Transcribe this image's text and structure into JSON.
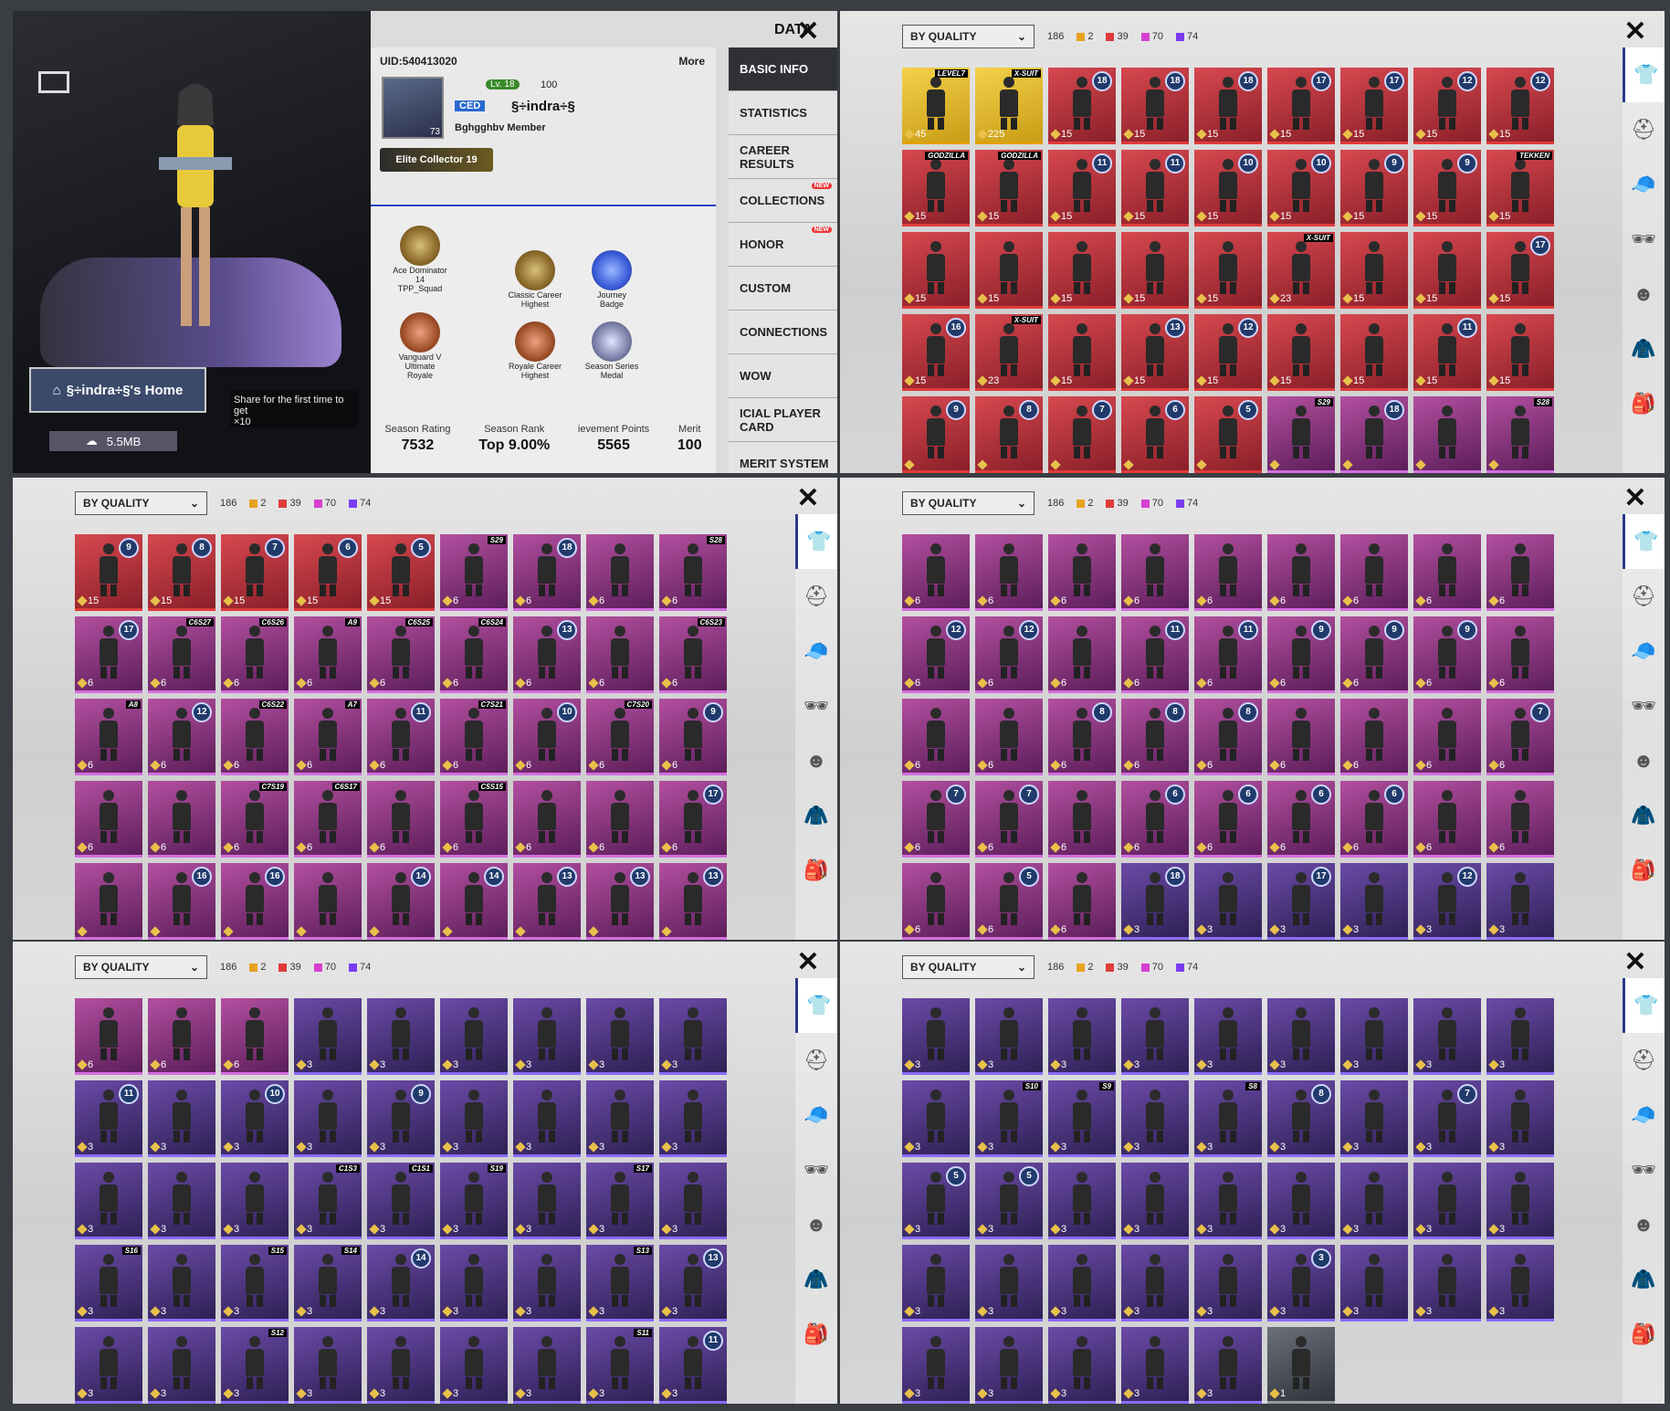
{
  "basic_info": {
    "title": "DATA",
    "uid": "UID:540413020",
    "more": "More",
    "level": "Lv. 18",
    "rating_small": "100",
    "crew_tag": "CED",
    "player_name": "§÷indra÷§",
    "clan": "Bghgghbv  Member",
    "avatar_level": "73",
    "elite": "Elite Collector 19",
    "home_name": "§÷indra÷§'s Home",
    "home_size": "5.5MB",
    "share_text": "Share for the first time to get",
    "share_reward": "×10",
    "medals": [
      {
        "label": "Ace Dominator 14",
        "sub": "TPP_Squad"
      },
      {
        "label": "Classic Career Highest",
        "sub": ""
      },
      {
        "label": "Journey Badge",
        "sub": ""
      },
      {
        "label": "Vanguard V",
        "sub": "Ultimate Royale"
      },
      {
        "label": "Royale Career Highest",
        "sub": ""
      },
      {
        "label": "Season Series Medal",
        "sub": ""
      }
    ],
    "stats": [
      {
        "label": "Season Rating",
        "value": "7532"
      },
      {
        "label": "Season Rank",
        "value": "Top 9.00%"
      },
      {
        "label": "ievement Points",
        "value": "5565"
      },
      {
        "label": "Merit",
        "value": "100"
      }
    ],
    "menu": [
      {
        "label": "BASIC INFO",
        "active": true
      },
      {
        "label": "STATISTICS"
      },
      {
        "label": "CAREER RESULTS"
      },
      {
        "label": "COLLECTIONS",
        "new": "NEW"
      },
      {
        "label": "HONOR",
        "new": "NEW"
      },
      {
        "label": "CUSTOM"
      },
      {
        "label": "CONNECTIONS"
      },
      {
        "label": "WOW"
      },
      {
        "label": "ICIAL PLAYER CARD"
      },
      {
        "label": "MERIT SYSTEM"
      }
    ]
  },
  "filter": {
    "sort": "BY QUALITY",
    "total": "186",
    "quality_counts": [
      {
        "color": "#e8a21f",
        "count": "2"
      },
      {
        "color": "#e03b3b",
        "count": "39"
      },
      {
        "color": "#d63fd0",
        "count": "70"
      },
      {
        "color": "#7a3cf0",
        "count": "74"
      }
    ]
  },
  "icons": {
    "close": "✕",
    "categories": [
      "outfit-icon",
      "helmet-icon",
      "cap-icon",
      "glasses-icon",
      "mask-icon",
      "jacket-icon",
      "backpack-icon"
    ]
  },
  "panels": [
    {
      "cards": [
        {
          "q": "gold",
          "n": "45",
          "tag": "LEVEL7"
        },
        {
          "q": "gold",
          "n": "225",
          "tag": "X-SUIT"
        },
        {
          "q": "red",
          "n": "15",
          "b": "18"
        },
        {
          "q": "red",
          "n": "15",
          "b": "18"
        },
        {
          "q": "red",
          "n": "15",
          "b": "18"
        },
        {
          "q": "red",
          "n": "15",
          "b": "17"
        },
        {
          "q": "red",
          "n": "15",
          "b": "17"
        },
        {
          "q": "red",
          "n": "15",
          "b": "12"
        },
        {
          "q": "red",
          "n": "15",
          "b": "12"
        },
        {
          "q": "red",
          "n": "15",
          "tag": "GODZILLA"
        },
        {
          "q": "red",
          "n": "15",
          "tag": "GODZILLA"
        },
        {
          "q": "red",
          "n": "15",
          "b": "11"
        },
        {
          "q": "red",
          "n": "15",
          "b": "11"
        },
        {
          "q": "red",
          "n": "15",
          "b": "10"
        },
        {
          "q": "red",
          "n": "15",
          "b": "10"
        },
        {
          "q": "red",
          "n": "15",
          "b": "9"
        },
        {
          "q": "red",
          "n": "15",
          "b": "9"
        },
        {
          "q": "red",
          "n": "15",
          "tag": "TEKKEN"
        },
        {
          "q": "red",
          "n": "15"
        },
        {
          "q": "red",
          "n": "15"
        },
        {
          "q": "red",
          "n": "15"
        },
        {
          "q": "red",
          "n": "15"
        },
        {
          "q": "red",
          "n": "15"
        },
        {
          "q": "red",
          "n": "23",
          "tag": "X-SUIT"
        },
        {
          "q": "red",
          "n": "15"
        },
        {
          "q": "red",
          "n": "15"
        },
        {
          "q": "red",
          "n": "15",
          "b": "17"
        },
        {
          "q": "red",
          "n": "15",
          "b": "16"
        },
        {
          "q": "red",
          "n": "23",
          "tag": "X-SUIT"
        },
        {
          "q": "red",
          "n": "15"
        },
        {
          "q": "red",
          "n": "15",
          "b": "13"
        },
        {
          "q": "red",
          "n": "15",
          "b": "12"
        },
        {
          "q": "red",
          "n": "15"
        },
        {
          "q": "red",
          "n": "15"
        },
        {
          "q": "red",
          "n": "15",
          "b": "11"
        },
        {
          "q": "red",
          "n": "15"
        },
        {
          "q": "red",
          "n": "",
          "b": "9"
        },
        {
          "q": "red",
          "n": "",
          "b": "8"
        },
        {
          "q": "red",
          "n": "",
          "b": "7"
        },
        {
          "q": "red",
          "n": "",
          "b": "6"
        },
        {
          "q": "red",
          "n": "",
          "b": "5"
        },
        {
          "q": "pink",
          "n": "",
          "tag": "S29"
        },
        {
          "q": "pink",
          "n": "",
          "b": "18"
        },
        {
          "q": "pink",
          "n": ""
        },
        {
          "q": "pink",
          "n": "",
          "tag": "S28"
        }
      ]
    },
    {
      "cards": [
        {
          "q": "red",
          "n": "15",
          "b": "9"
        },
        {
          "q": "red",
          "n": "15",
          "b": "8"
        },
        {
          "q": "red",
          "n": "15",
          "b": "7"
        },
        {
          "q": "red",
          "n": "15",
          "b": "6"
        },
        {
          "q": "red",
          "n": "15",
          "b": "5"
        },
        {
          "q": "pink",
          "n": "6",
          "tag": "S29"
        },
        {
          "q": "pink",
          "n": "6",
          "b": "18"
        },
        {
          "q": "pink",
          "n": "6"
        },
        {
          "q": "pink",
          "n": "6",
          "tag": "S28"
        },
        {
          "q": "pink",
          "n": "6",
          "b": "17"
        },
        {
          "q": "pink",
          "n": "6",
          "tag": "C6S27"
        },
        {
          "q": "pink",
          "n": "6",
          "tag": "C6S26"
        },
        {
          "q": "pink",
          "n": "6",
          "tag": "A9"
        },
        {
          "q": "pink",
          "n": "6",
          "tag": "C6S25"
        },
        {
          "q": "pink",
          "n": "6",
          "tag": "C6S24"
        },
        {
          "q": "pink",
          "n": "6",
          "b": "13"
        },
        {
          "q": "pink",
          "n": "6"
        },
        {
          "q": "pink",
          "n": "6",
          "tag": "C6S23"
        },
        {
          "q": "pink",
          "n": "6",
          "tag": "A8"
        },
        {
          "q": "pink",
          "n": "6",
          "b": "12"
        },
        {
          "q": "pink",
          "n": "6",
          "tag": "C6S22"
        },
        {
          "q": "pink",
          "n": "6",
          "tag": "A7"
        },
        {
          "q": "pink",
          "n": "6",
          "b": "11"
        },
        {
          "q": "pink",
          "n": "6",
          "tag": "C7S21"
        },
        {
          "q": "pink",
          "n": "6",
          "b": "10"
        },
        {
          "q": "pink",
          "n": "6",
          "tag": "C7S20"
        },
        {
          "q": "pink",
          "n": "6",
          "b": "9"
        },
        {
          "q": "pink",
          "n": "6"
        },
        {
          "q": "pink",
          "n": "6"
        },
        {
          "q": "pink",
          "n": "6",
          "tag": "C7S19"
        },
        {
          "q": "pink",
          "n": "6",
          "tag": "C6S17"
        },
        {
          "q": "pink",
          "n": "6"
        },
        {
          "q": "pink",
          "n": "6",
          "tag": "C5S15"
        },
        {
          "q": "pink",
          "n": "6"
        },
        {
          "q": "pink",
          "n": "6"
        },
        {
          "q": "pink",
          "n": "6",
          "b": "17"
        },
        {
          "q": "pink",
          "n": ""
        },
        {
          "q": "pink",
          "n": "",
          "b": "16"
        },
        {
          "q": "pink",
          "n": "",
          "b": "16"
        },
        {
          "q": "pink",
          "n": ""
        },
        {
          "q": "pink",
          "n": "",
          "b": "14"
        },
        {
          "q": "pink",
          "n": "",
          "b": "14"
        },
        {
          "q": "pink",
          "n": "",
          "b": "13"
        },
        {
          "q": "pink",
          "n": "",
          "b": "13"
        },
        {
          "q": "pink",
          "n": "",
          "b": "13"
        }
      ]
    },
    {
      "cards": [
        {
          "q": "pink",
          "n": "6"
        },
        {
          "q": "pink",
          "n": "6"
        },
        {
          "q": "pink",
          "n": "6"
        },
        {
          "q": "pink",
          "n": "6"
        },
        {
          "q": "pink",
          "n": "6"
        },
        {
          "q": "pink",
          "n": "6"
        },
        {
          "q": "pink",
          "n": "6"
        },
        {
          "q": "pink",
          "n": "6"
        },
        {
          "q": "pink",
          "n": "6"
        },
        {
          "q": "pink",
          "n": "6",
          "b": "12"
        },
        {
          "q": "pink",
          "n": "6",
          "b": "12"
        },
        {
          "q": "pink",
          "n": "6"
        },
        {
          "q": "pink",
          "n": "6",
          "b": "11"
        },
        {
          "q": "pink",
          "n": "6",
          "b": "11"
        },
        {
          "q": "pink",
          "n": "6",
          "b": "9"
        },
        {
          "q": "pink",
          "n": "6",
          "b": "9"
        },
        {
          "q": "pink",
          "n": "6",
          "b": "9"
        },
        {
          "q": "pink",
          "n": "6"
        },
        {
          "q": "pink",
          "n": "6"
        },
        {
          "q": "pink",
          "n": "6"
        },
        {
          "q": "pink",
          "n": "6",
          "b": "8"
        },
        {
          "q": "pink",
          "n": "6",
          "b": "8"
        },
        {
          "q": "pink",
          "n": "6",
          "b": "8"
        },
        {
          "q": "pink",
          "n": "6"
        },
        {
          "q": "pink",
          "n": "6"
        },
        {
          "q": "pink",
          "n": "6"
        },
        {
          "q": "pink",
          "n": "6",
          "b": "7"
        },
        {
          "q": "pink",
          "n": "6",
          "b": "7"
        },
        {
          "q": "pink",
          "n": "6",
          "b": "7"
        },
        {
          "q": "pink",
          "n": "6"
        },
        {
          "q": "pink",
          "n": "6",
          "b": "6"
        },
        {
          "q": "pink",
          "n": "6",
          "b": "6"
        },
        {
          "q": "pink",
          "n": "6",
          "b": "6"
        },
        {
          "q": "pink",
          "n": "6",
          "b": "6"
        },
        {
          "q": "pink",
          "n": "6"
        },
        {
          "q": "pink",
          "n": "6"
        },
        {
          "q": "pink",
          "n": "6"
        },
        {
          "q": "pink",
          "n": "6",
          "b": "5"
        },
        {
          "q": "pink",
          "n": "6"
        },
        {
          "q": "purple",
          "n": "3",
          "b": "18"
        },
        {
          "q": "purple",
          "n": "3"
        },
        {
          "q": "purple",
          "n": "3",
          "b": "17"
        },
        {
          "q": "purple",
          "n": "3"
        },
        {
          "q": "purple",
          "n": "3",
          "b": "12"
        },
        {
          "q": "purple",
          "n": "3"
        }
      ]
    },
    {
      "cards": [
        {
          "q": "pink",
          "n": "6"
        },
        {
          "q": "pink",
          "n": "6"
        },
        {
          "q": "pink",
          "n": "6"
        },
        {
          "q": "purple",
          "n": "3"
        },
        {
          "q": "purple",
          "n": "3"
        },
        {
          "q": "purple",
          "n": "3"
        },
        {
          "q": "purple",
          "n": "3"
        },
        {
          "q": "purple",
          "n": "3"
        },
        {
          "q": "purple",
          "n": "3"
        },
        {
          "q": "purple",
          "n": "3",
          "b": "11"
        },
        {
          "q": "purple",
          "n": "3"
        },
        {
          "q": "purple",
          "n": "3",
          "b": "10"
        },
        {
          "q": "purple",
          "n": "3"
        },
        {
          "q": "purple",
          "n": "3",
          "b": "9"
        },
        {
          "q": "purple",
          "n": "3"
        },
        {
          "q": "purple",
          "n": "3"
        },
        {
          "q": "purple",
          "n": "3"
        },
        {
          "q": "purple",
          "n": "3"
        },
        {
          "q": "purple",
          "n": "3"
        },
        {
          "q": "purple",
          "n": "3"
        },
        {
          "q": "purple",
          "n": "3"
        },
        {
          "q": "purple",
          "n": "3",
          "tag": "C1S3"
        },
        {
          "q": "purple",
          "n": "3",
          "tag": "C1S1"
        },
        {
          "q": "purple",
          "n": "3",
          "tag": "S19"
        },
        {
          "q": "purple",
          "n": "3"
        },
        {
          "q": "purple",
          "n": "3",
          "tag": "S17"
        },
        {
          "q": "purple",
          "n": "3"
        },
        {
          "q": "purple",
          "n": "3",
          "tag": "S16"
        },
        {
          "q": "purple",
          "n": "3"
        },
        {
          "q": "purple",
          "n": "3",
          "tag": "S15"
        },
        {
          "q": "purple",
          "n": "3",
          "tag": "S14"
        },
        {
          "q": "purple",
          "n": "3",
          "b": "14"
        },
        {
          "q": "purple",
          "n": "3"
        },
        {
          "q": "purple",
          "n": "3"
        },
        {
          "q": "purple",
          "n": "3",
          "tag": "S13"
        },
        {
          "q": "purple",
          "n": "3",
          "b": "13"
        },
        {
          "q": "purple",
          "n": "3"
        },
        {
          "q": "purple",
          "n": "3"
        },
        {
          "q": "purple",
          "n": "3",
          "tag": "S12"
        },
        {
          "q": "purple",
          "n": "3"
        },
        {
          "q": "purple",
          "n": "3"
        },
        {
          "q": "purple",
          "n": "3"
        },
        {
          "q": "purple",
          "n": "3"
        },
        {
          "q": "purple",
          "n": "3",
          "tag": "S11"
        },
        {
          "q": "purple",
          "n": "3",
          "b": "11"
        }
      ]
    },
    {
      "cards": [
        {
          "q": "purple",
          "n": "3"
        },
        {
          "q": "purple",
          "n": "3"
        },
        {
          "q": "purple",
          "n": "3"
        },
        {
          "q": "purple",
          "n": "3"
        },
        {
          "q": "purple",
          "n": "3"
        },
        {
          "q": "purple",
          "n": "3"
        },
        {
          "q": "purple",
          "n": "3"
        },
        {
          "q": "purple",
          "n": "3"
        },
        {
          "q": "purple",
          "n": "3"
        },
        {
          "q": "purple",
          "n": "3"
        },
        {
          "q": "purple",
          "n": "3",
          "tag": "S10"
        },
        {
          "q": "purple",
          "n": "3",
          "tag": "S9"
        },
        {
          "q": "purple",
          "n": "3"
        },
        {
          "q": "purple",
          "n": "3",
          "tag": "S8"
        },
        {
          "q": "purple",
          "n": "3",
          "b": "8"
        },
        {
          "q": "purple",
          "n": "3"
        },
        {
          "q": "purple",
          "n": "3",
          "b": "7"
        },
        {
          "q": "purple",
          "n": "3"
        },
        {
          "q": "purple",
          "n": "3",
          "b": "5"
        },
        {
          "q": "purple",
          "n": "3",
          "b": "5"
        },
        {
          "q": "purple",
          "n": "3"
        },
        {
          "q": "purple",
          "n": "3"
        },
        {
          "q": "purple",
          "n": "3"
        },
        {
          "q": "purple",
          "n": "3"
        },
        {
          "q": "purple",
          "n": "3"
        },
        {
          "q": "purple",
          "n": "3"
        },
        {
          "q": "purple",
          "n": "3"
        },
        {
          "q": "purple",
          "n": "3"
        },
        {
          "q": "purple",
          "n": "3"
        },
        {
          "q": "purple",
          "n": "3"
        },
        {
          "q": "purple",
          "n": "3"
        },
        {
          "q": "purple",
          "n": "3"
        },
        {
          "q": "purple",
          "n": "3",
          "b": "3"
        },
        {
          "q": "purple",
          "n": "3"
        },
        {
          "q": "purple",
          "n": "3"
        },
        {
          "q": "purple",
          "n": "3"
        },
        {
          "q": "purple",
          "n": "3"
        },
        {
          "q": "purple",
          "n": "3"
        },
        {
          "q": "purple",
          "n": "3"
        },
        {
          "q": "purple",
          "n": "3"
        },
        {
          "q": "purple",
          "n": "3"
        },
        {
          "q": "grey",
          "n": "1"
        }
      ]
    }
  ]
}
